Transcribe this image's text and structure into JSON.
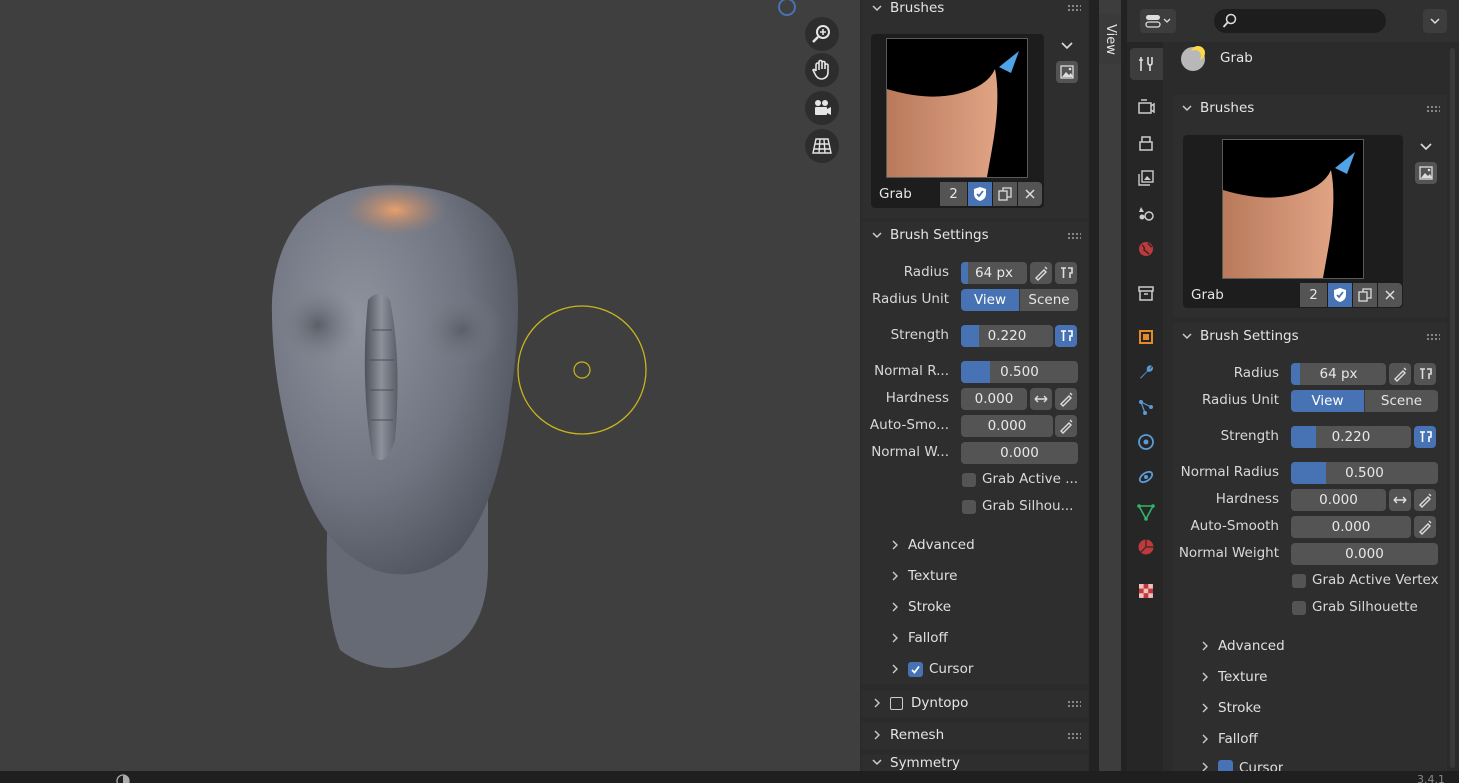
{
  "colors": {
    "accent": "#4772b3",
    "panel": "#2e2e2e",
    "field": "#545454",
    "viewport": "#3f3f3f"
  },
  "nav_icons": [
    "zoom-icon",
    "hand-pan-icon",
    "camera-icon",
    "grid-ortho-icon"
  ],
  "left_panel": {
    "brushes_title": "Brushes",
    "brush_name": "Grab",
    "brush_users": "2",
    "brush_settings_title": "Brush Settings",
    "radius_label": "Radius",
    "radius_value": "64 px",
    "radius_fill": 0.1,
    "radius_unit_label": "Radius Unit",
    "unit_view": "View",
    "unit_scene": "Scene",
    "strength_label": "Strength",
    "strength_value": "0.220",
    "strength_fill": 0.22,
    "normal_radius_label": "Normal R...",
    "normal_radius_value": "0.500",
    "normal_radius_fill": 0.25,
    "hardness_label": "Hardness",
    "hardness_value": "0.000",
    "auto_smooth_label": "Auto-Smo...",
    "auto_smooth_value": "0.000",
    "normal_weight_label": "Normal W...",
    "normal_weight_value": "0.000",
    "grab_active_label": "Grab Active ...",
    "grab_silhouette_label": "Grab Silhou...",
    "advanced": "Advanced",
    "texture": "Texture",
    "stroke": "Stroke",
    "falloff": "Falloff",
    "cursor": "Cursor",
    "dyntopo": "Dyntopo",
    "remesh": "Remesh",
    "symmetry": "Symmetry"
  },
  "view_tab": "View",
  "right_panel": {
    "search_placeholder": "",
    "tool_name": "Grab",
    "brushes_title": "Brushes",
    "brush_name": "Grab",
    "brush_users": "2",
    "brush_settings_title": "Brush Settings",
    "radius_label": "Radius",
    "radius_value": "64 px",
    "radius_unit_label": "Radius Unit",
    "unit_view": "View",
    "unit_scene": "Scene",
    "strength_label": "Strength",
    "strength_value": "0.220",
    "normal_radius_label": "Normal Radius",
    "normal_radius_value": "0.500",
    "hardness_label": "Hardness",
    "hardness_value": "0.000",
    "auto_smooth_label": "Auto-Smooth",
    "auto_smooth_value": "0.000",
    "normal_weight_label": "Normal Weight",
    "normal_weight_value": "0.000",
    "grab_active_label": "Grab Active Vertex",
    "grab_silhouette_label": "Grab Silhouette",
    "advanced": "Advanced",
    "texture": "Texture",
    "stroke": "Stroke",
    "falloff": "Falloff",
    "cursor": "Cursor"
  },
  "status_version": "3.4.1"
}
